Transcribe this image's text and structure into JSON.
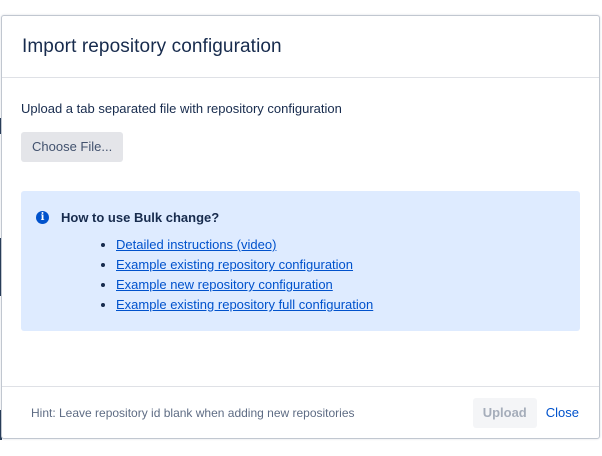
{
  "dialog": {
    "title": "Import repository configuration",
    "description": "Upload a tab separated file with repository configuration",
    "choose_file_label": "Choose File..."
  },
  "info": {
    "icon": "info-icon",
    "heading": "How to use Bulk change?",
    "links": [
      "Detailed instructions (video)",
      "Example existing repository configuration",
      "Example new repository configuration",
      "Example existing repository full configuration"
    ]
  },
  "footer": {
    "hint": "Hint: Leave repository id blank when adding new repositories",
    "upload_label": "Upload",
    "close_label": "Close"
  },
  "colors": {
    "accent": "#0052cc",
    "info_background": "#deebff",
    "title_text": "#172b4d"
  }
}
